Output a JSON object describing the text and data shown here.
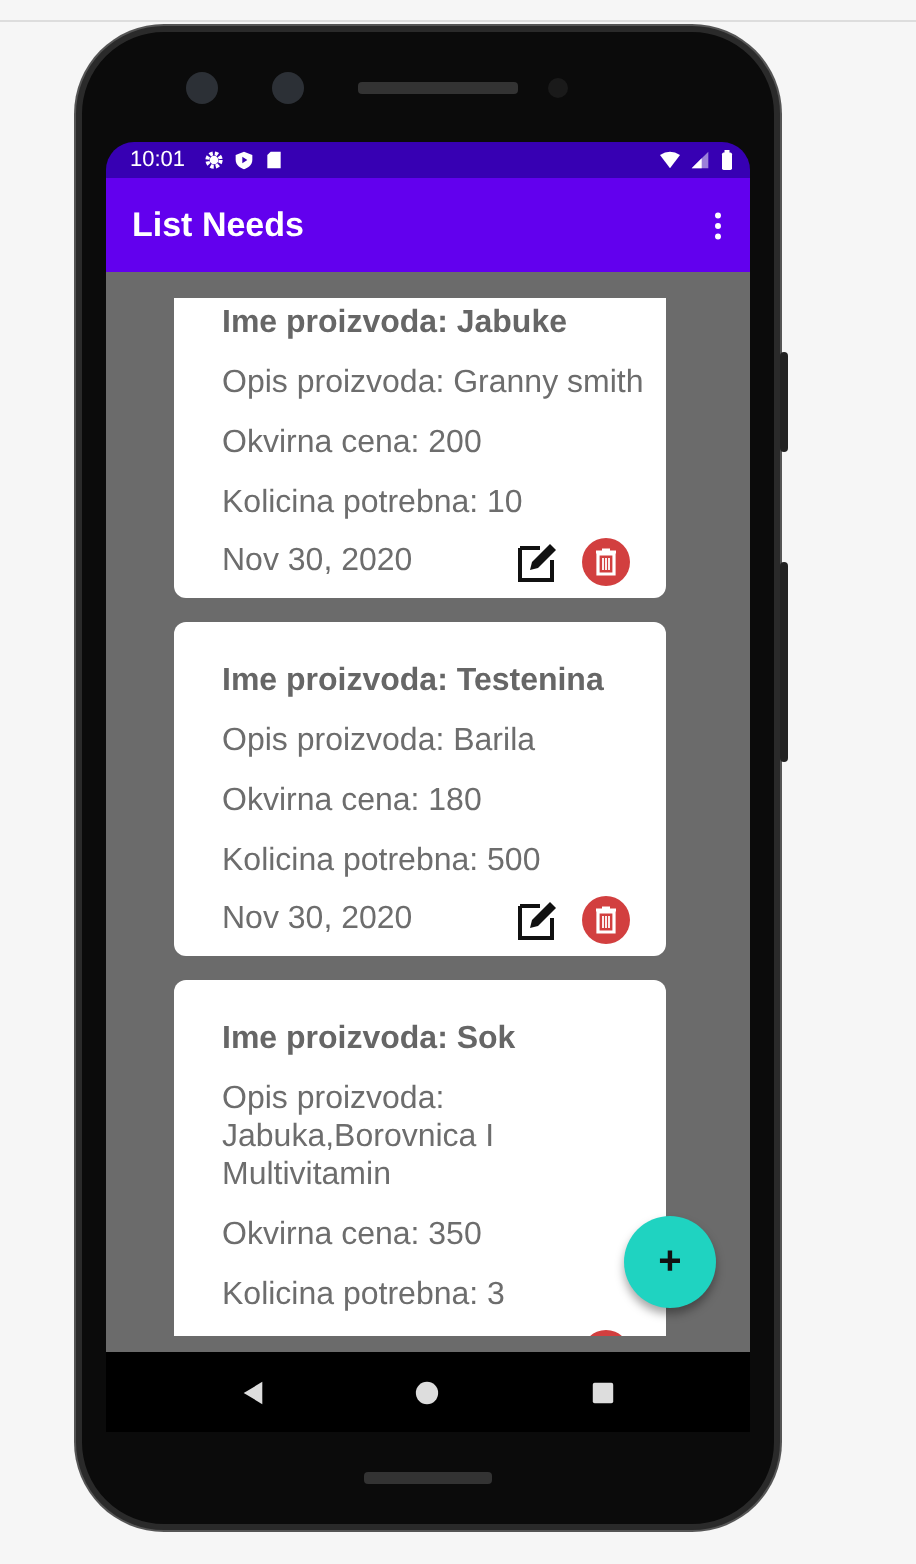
{
  "status_bar": {
    "time": "10:01"
  },
  "app_bar": {
    "title": "List Needs"
  },
  "needs": [
    {
      "name": "Ime proizvoda: Jabuke",
      "description": "Opis proizvoda: Granny smith",
      "price": "Okvirna cena: 200",
      "quantity": "Kolicina potrebna: 10",
      "date": "Nov 30, 2020"
    },
    {
      "name": "Ime proizvoda: Testenina",
      "description": "Opis proizvoda: Barila",
      "price": "Okvirna cena: 180",
      "quantity": "Kolicina potrebna: 500",
      "date": "Nov 30, 2020"
    },
    {
      "name": "Ime proizvoda: Sok",
      "description": "Opis proizvoda: Jabuka,Borovnica I Multivitamin",
      "price": "Okvirna cena: 350",
      "quantity": "Kolicina potrebna: 3"
    }
  ],
  "fab": {
    "label": "+"
  }
}
